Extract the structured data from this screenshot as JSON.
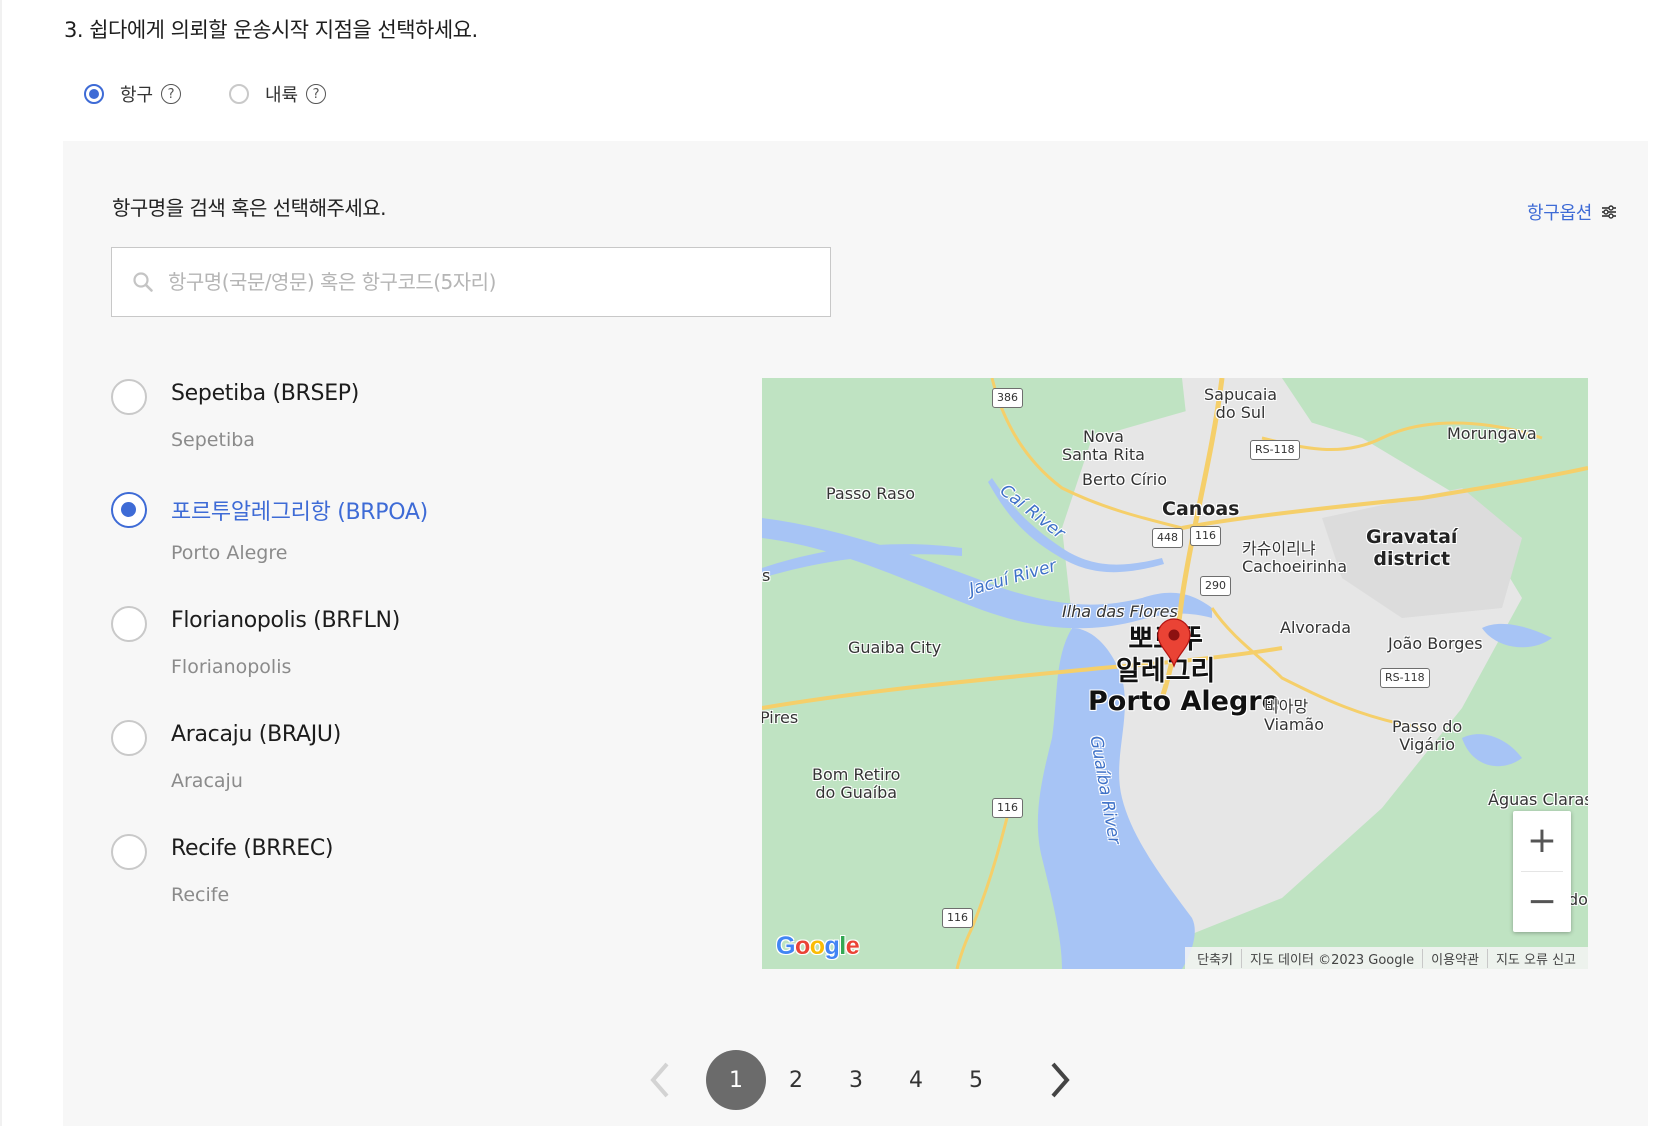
{
  "question": {
    "title": "3. 쉽다에게 의뢰할 운송시작 지점을 선택하세요."
  },
  "mode": {
    "selected": "항구",
    "options": [
      {
        "label": "항구",
        "selected": true,
        "help_icon": "question-circle-icon"
      },
      {
        "label": "내륙",
        "selected": false,
        "help_icon": "question-circle-icon"
      }
    ]
  },
  "panel": {
    "label": "항구명을 검색 혹은 선택해주세요.",
    "options_link": {
      "label": "항구옵션",
      "icon": "sliders-icon"
    },
    "search": {
      "placeholder": "항구명(국문/영문) 혹은 항구코드(5자리)",
      "value": "",
      "icon": "search-icon"
    },
    "ports": [
      {
        "name": "Sepetiba (BRSEP)",
        "city": "Sepetiba",
        "selected": false
      },
      {
        "name": "포르투알레그리항 (BRPOA)",
        "city": "Porto Alegre",
        "selected": true
      },
      {
        "name": "Florianopolis (BRFLN)",
        "city": "Florianopolis",
        "selected": false
      },
      {
        "name": "Aracaju (BRAJU)",
        "city": "Aracaju",
        "selected": false
      },
      {
        "name": "Recife (BRREC)",
        "city": "Recife",
        "selected": false
      }
    ]
  },
  "map": {
    "labels": {
      "sapucaia": "Sapucaia\ndo Sul",
      "nova_santa_rita": "Nova\nSanta Rita",
      "berto_cirio": "Berto Círio",
      "morungava": "Morungava",
      "passo_raso": "Passo Raso",
      "canoas": "Canoas",
      "cachoeirinha": "카슈이리냐\nCachoeirinha",
      "gravatai": "Gravataí\ndistrict",
      "ilha": "Ilha das Flores",
      "alvorada": "Alvorada",
      "joao_borges": "João Borges",
      "guaiba_city": "Guaiba City",
      "porto_alegre_kr": "뽀르뚜\n알레그리",
      "porto_alegre": "Porto Alegre",
      "viamao": "비아망\nViamão",
      "passo_vigario": "Passo do\nVigário",
      "pires": "Pires",
      "s_edge": "s",
      "bom_retiro": "Bom Retiro\ndo Guaíba",
      "aguas_claras": "Águas Claras",
      "do_edge": "do"
    },
    "water_labels": {
      "cai": "Caí River",
      "jacui": "Jacuí River",
      "guaiba": "Guaíba River"
    },
    "shields": {
      "s386": "386",
      "rs118a": "RS-118",
      "s448": "448",
      "s116a": "116",
      "s290": "290",
      "rs118b": "RS-118",
      "s116b": "116",
      "s116c": "116"
    },
    "zoom_in": "+",
    "zoom_out": "−",
    "attribution": {
      "shortcuts": "단축키",
      "data": "지도 데이터 ©2023 Google",
      "terms": "이용약관",
      "report": "지도 오류 신고"
    },
    "logo": "Google",
    "colors": {
      "land": "#bfe3c2",
      "urban": "#e8e8e8",
      "water": "#a7c4f5",
      "road": "#f5cf6a",
      "pin": "#ea4335"
    }
  },
  "pagination": {
    "prev_icon": "chevron-left-icon",
    "next_icon": "chevron-right-icon",
    "pages": [
      "1",
      "2",
      "3",
      "4",
      "5"
    ],
    "current": "1"
  },
  "colors": {
    "accent": "#3e6bd6",
    "panel_bg": "#f7f7f7",
    "active_page": "#6b6b6b"
  }
}
